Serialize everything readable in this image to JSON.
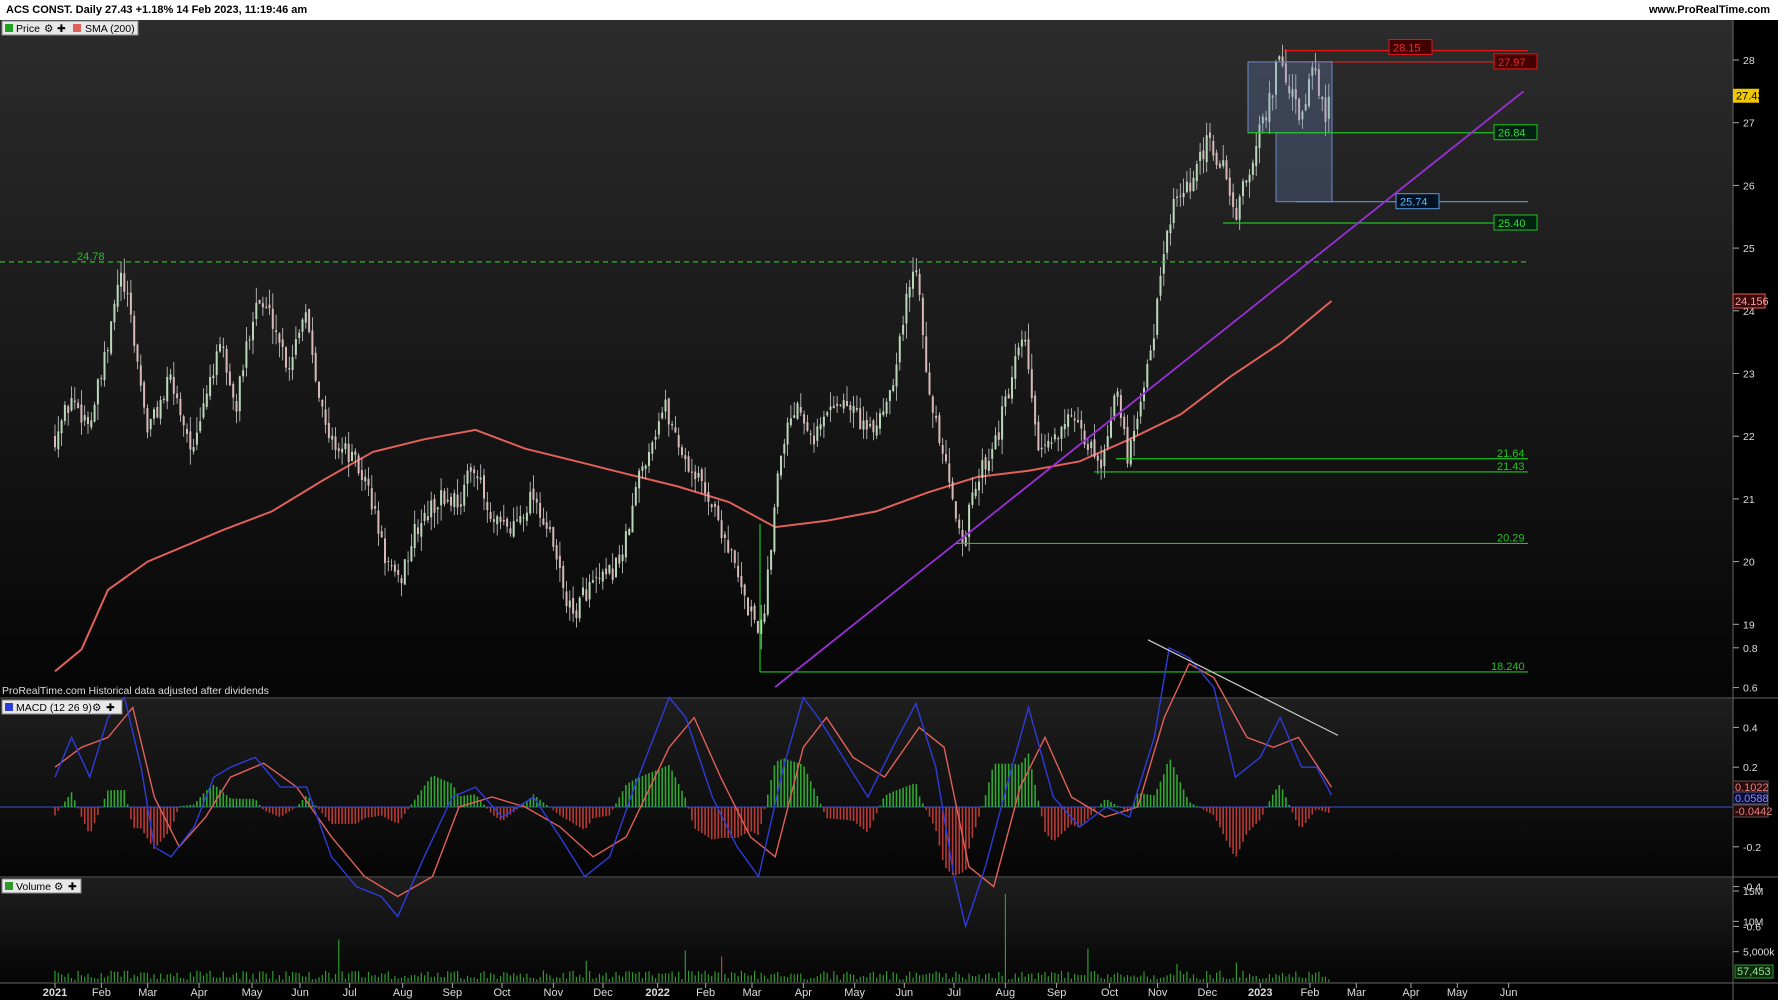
{
  "header": {
    "title": "ACS CONST. Daily 27.43 +1.18% 14 Feb 2023, 11:19:46 am",
    "site": "www.ProRealTime.com"
  },
  "footnote": "ProRealTime.com  Historical data adjusted after dividends",
  "colors": {
    "background": "#000000",
    "sma": "#e0605a",
    "trendline": "#9a2fd8",
    "support": "#22c122",
    "resistance": "#e01818",
    "macd": "#2e3cd8",
    "signal": "#e0605a",
    "hist_pos": "#2ea82e",
    "hist_neg": "#b83a36",
    "volume": "#2e9a2e",
    "box": "#4a6a9a",
    "price_tag": "#f0c800"
  },
  "panels": {
    "price": {
      "tag_label": "Price",
      "sma_label": "SMA (200)"
    },
    "macd": {
      "tag_label": "MACD (12 26 9)"
    },
    "volume": {
      "tag_label": "Volume"
    }
  },
  "chart_data": [
    {
      "type": "candlestick",
      "panel": "price",
      "ylim": [
        18.0,
        28.4
      ],
      "y_ticks": [
        19,
        20,
        21,
        22,
        23,
        24,
        25,
        26,
        27,
        28
      ],
      "x_ticks": [
        "2021",
        "Feb",
        "Mar",
        "Apr",
        "May",
        "Jun",
        "Jul",
        "Aug",
        "Sep",
        "Oct",
        "Nov",
        "Dec",
        "2022",
        "Feb",
        "Mar",
        "Apr",
        "May",
        "Jun",
        "Jul",
        "Aug",
        "Sep",
        "Oct",
        "Nov",
        "Dec",
        "2023",
        "Feb",
        "Mar",
        "Apr",
        "May",
        "Jun"
      ],
      "close_path": [
        [
          "2021-01-04",
          22.0
        ],
        [
          "2021-01-14",
          22.6
        ],
        [
          "2021-01-25",
          22.2
        ],
        [
          "2021-02-05",
          23.4
        ],
        [
          "2021-02-12",
          24.6
        ],
        [
          "2021-02-18",
          24.0
        ],
        [
          "2021-03-01",
          22.1
        ],
        [
          "2021-03-15",
          22.9
        ],
        [
          "2021-03-29",
          21.7
        ],
        [
          "2021-04-07",
          22.9
        ],
        [
          "2021-04-15",
          23.4
        ],
        [
          "2021-04-23",
          22.4
        ],
        [
          "2021-05-05",
          24.2
        ],
        [
          "2021-05-15",
          23.9
        ],
        [
          "2021-05-25",
          23.1
        ],
        [
          "2021-06-04",
          24.1
        ],
        [
          "2021-06-17",
          22.0
        ],
        [
          "2021-07-01",
          21.7
        ],
        [
          "2021-07-12",
          21.2
        ],
        [
          "2021-07-22",
          20.1
        ],
        [
          "2021-07-30",
          19.6
        ],
        [
          "2021-08-10",
          20.5
        ],
        [
          "2021-08-24",
          21.0
        ],
        [
          "2021-09-06",
          21.0
        ],
        [
          "2021-09-14",
          21.6
        ],
        [
          "2021-09-24",
          20.6
        ],
        [
          "2021-10-06",
          20.5
        ],
        [
          "2021-10-20",
          21.1
        ],
        [
          "2021-10-31",
          20.3
        ],
        [
          "2021-11-12",
          19.1
        ],
        [
          "2021-11-22",
          19.6
        ],
        [
          "2021-12-03",
          19.7
        ],
        [
          "2021-12-14",
          20.2
        ],
        [
          "2021-12-23",
          21.4
        ],
        [
          "2022-01-07",
          22.5
        ],
        [
          "2022-01-20",
          21.6
        ],
        [
          "2022-02-02",
          21.1
        ],
        [
          "2022-02-14",
          20.3
        ],
        [
          "2022-02-24",
          19.4
        ],
        [
          "2022-03-07",
          18.9
        ],
        [
          "2022-03-18",
          21.8
        ],
        [
          "2022-03-28",
          22.6
        ],
        [
          "2022-04-08",
          22.0
        ],
        [
          "2022-04-20",
          22.6
        ],
        [
          "2022-05-02",
          22.4
        ],
        [
          "2022-05-12",
          22.0
        ],
        [
          "2022-05-24",
          22.8
        ],
        [
          "2022-06-04",
          24.4
        ],
        [
          "2022-06-09",
          24.8
        ],
        [
          "2022-06-16",
          22.6
        ],
        [
          "2022-06-25",
          21.6
        ],
        [
          "2022-07-01",
          20.8
        ],
        [
          "2022-07-07",
          20.4
        ],
        [
          "2022-07-15",
          21.3
        ],
        [
          "2022-07-28",
          22.1
        ],
        [
          "2022-08-12",
          23.6
        ],
        [
          "2022-08-22",
          21.6
        ],
        [
          "2022-09-06",
          22.3
        ],
        [
          "2022-09-19",
          21.9
        ],
        [
          "2022-09-29",
          21.6
        ],
        [
          "2022-10-06",
          22.8
        ],
        [
          "2022-10-14",
          21.7
        ],
        [
          "2022-10-28",
          23.4
        ],
        [
          "2022-11-09",
          25.6
        ],
        [
          "2022-11-22",
          26.0
        ],
        [
          "2022-12-01",
          26.7
        ],
        [
          "2022-12-12",
          26.2
        ],
        [
          "2022-12-18",
          25.5
        ],
        [
          "2022-12-28",
          26.4
        ],
        [
          "2023-01-09",
          27.5
        ],
        [
          "2023-01-13",
          28.0
        ],
        [
          "2023-01-20",
          27.5
        ],
        [
          "2023-01-27",
          27.0
        ],
        [
          "2023-02-03",
          27.9
        ],
        [
          "2023-02-10",
          27.1
        ],
        [
          "2023-02-14",
          27.43
        ]
      ],
      "sma_200": [
        [
          "2021-01-04",
          18.25
        ],
        [
          "2021-01-20",
          18.6
        ],
        [
          "2021-02-05",
          19.55
        ],
        [
          "2021-03-01",
          20.0
        ],
        [
          "2021-04-15",
          20.5
        ],
        [
          "2021-05-15",
          20.8
        ],
        [
          "2021-06-15",
          21.3
        ],
        [
          "2021-07-15",
          21.75
        ],
        [
          "2021-08-15",
          21.95
        ],
        [
          "2021-09-15",
          22.1
        ],
        [
          "2021-10-15",
          21.8
        ],
        [
          "2021-11-15",
          21.6
        ],
        [
          "2021-12-15",
          21.4
        ],
        [
          "2022-01-15",
          21.2
        ],
        [
          "2022-02-15",
          20.95
        ],
        [
          "2022-03-15",
          20.55
        ],
        [
          "2022-04-15",
          20.65
        ],
        [
          "2022-05-15",
          20.8
        ],
        [
          "2022-06-15",
          21.1
        ],
        [
          "2022-07-15",
          21.35
        ],
        [
          "2022-08-15",
          21.45
        ],
        [
          "2022-09-15",
          21.6
        ],
        [
          "2022-10-15",
          21.95
        ],
        [
          "2022-11-15",
          22.35
        ],
        [
          "2022-12-15",
          22.95
        ],
        [
          "2023-01-15",
          23.5
        ],
        [
          "2023-02-14",
          24.156
        ]
      ],
      "levels": [
        {
          "label": "24.78",
          "value": 24.78,
          "style": "dashed"
        },
        {
          "label": "27.97",
          "value": 27.97,
          "style": "resistance"
        },
        {
          "label": "28.15",
          "value": 28.15,
          "style": "resistance"
        },
        {
          "label": "26.84",
          "value": 26.84,
          "style": "support"
        },
        {
          "label": "25.74",
          "value": 25.74,
          "style": "box"
        },
        {
          "label": "25.40",
          "value": 25.4,
          "style": "support"
        },
        {
          "label": "21.64",
          "value": 21.64,
          "style": "support"
        },
        {
          "label": "21.43",
          "value": 21.43,
          "style": "support"
        },
        {
          "label": "20.29",
          "value": 20.29,
          "style": "support"
        },
        {
          "label": "18.240",
          "value": 18.24,
          "style": "support"
        }
      ],
      "trendline": [
        [
          "2022-03-15",
          18.0
        ],
        [
          "2023-06-10",
          27.5
        ]
      ],
      "last_price": "27.43",
      "sma_last": "24.156"
    },
    {
      "type": "line",
      "panel": "macd",
      "ylim": [
        -0.7,
        0.9
      ],
      "y_ticks": [
        "0.8",
        "0.6",
        "0.4",
        "0.2",
        "0",
        "-0.2",
        "-0.4",
        "-0.6"
      ],
      "macd": [
        [
          "2021-01-04",
          0.15
        ],
        [
          "2021-01-14",
          0.35
        ],
        [
          "2021-01-25",
          0.15
        ],
        [
          "2021-02-05",
          0.45
        ],
        [
          "2021-02-15",
          0.55
        ],
        [
          "2021-02-25",
          0.2
        ],
        [
          "2021-03-05",
          -0.2
        ],
        [
          "2021-03-15",
          -0.25
        ],
        [
          "2021-03-29",
          -0.1
        ],
        [
          "2021-04-10",
          0.15
        ],
        [
          "2021-04-20",
          0.2
        ],
        [
          "2021-05-05",
          0.25
        ],
        [
          "2021-05-20",
          0.1
        ],
        [
          "2021-06-05",
          0.1
        ],
        [
          "2021-06-20",
          -0.25
        ],
        [
          "2021-07-05",
          -0.4
        ],
        [
          "2021-07-20",
          -0.45
        ],
        [
          "2021-07-30",
          -0.55
        ],
        [
          "2021-08-15",
          -0.25
        ],
        [
          "2021-09-01",
          0.05
        ],
        [
          "2021-09-15",
          0.1
        ],
        [
          "2021-10-01",
          -0.05
        ],
        [
          "2021-10-20",
          0.05
        ],
        [
          "2021-11-05",
          -0.15
        ],
        [
          "2021-11-20",
          -0.35
        ],
        [
          "2021-12-05",
          -0.25
        ],
        [
          "2021-12-20",
          0.1
        ],
        [
          "2022-01-10",
          0.55
        ],
        [
          "2022-01-20",
          0.45
        ],
        [
          "2022-02-05",
          0.05
        ],
        [
          "2022-02-20",
          -0.2
        ],
        [
          "2022-03-05",
          -0.35
        ],
        [
          "2022-03-20",
          0.2
        ],
        [
          "2022-04-01",
          0.55
        ],
        [
          "2022-04-10",
          0.45
        ],
        [
          "2022-04-25",
          0.25
        ],
        [
          "2022-05-10",
          0.05
        ],
        [
          "2022-05-25",
          0.3
        ],
        [
          "2022-06-08",
          0.52
        ],
        [
          "2022-06-20",
          0.2
        ],
        [
          "2022-07-01",
          -0.35
        ],
        [
          "2022-07-08",
          -0.6
        ],
        [
          "2022-07-20",
          -0.3
        ],
        [
          "2022-08-05",
          0.2
        ],
        [
          "2022-08-15",
          0.5
        ],
        [
          "2022-08-30",
          0.05
        ],
        [
          "2022-09-15",
          -0.1
        ],
        [
          "2022-10-01",
          0.0
        ],
        [
          "2022-10-15",
          -0.05
        ],
        [
          "2022-10-30",
          0.35
        ],
        [
          "2022-11-08",
          0.8
        ],
        [
          "2022-11-20",
          0.75
        ],
        [
          "2022-12-05",
          0.6
        ],
        [
          "2022-12-18",
          0.15
        ],
        [
          "2023-01-02",
          0.25
        ],
        [
          "2023-01-14",
          0.45
        ],
        [
          "2023-01-27",
          0.2
        ],
        [
          "2023-02-05",
          0.2
        ],
        [
          "2023-02-14",
          0.06
        ]
      ],
      "signal": [
        [
          "2021-01-04",
          0.2
        ],
        [
          "2021-01-20",
          0.3
        ],
        [
          "2021-02-05",
          0.35
        ],
        [
          "2021-02-20",
          0.5
        ],
        [
          "2021-03-05",
          0.05
        ],
        [
          "2021-03-20",
          -0.2
        ],
        [
          "2021-04-05",
          -0.05
        ],
        [
          "2021-04-20",
          0.15
        ],
        [
          "2021-05-10",
          0.22
        ],
        [
          "2021-05-30",
          0.1
        ],
        [
          "2021-06-20",
          -0.15
        ],
        [
          "2021-07-10",
          -0.35
        ],
        [
          "2021-07-30",
          -0.45
        ],
        [
          "2021-08-20",
          -0.35
        ],
        [
          "2021-09-05",
          0.0
        ],
        [
          "2021-09-25",
          0.05
        ],
        [
          "2021-10-15",
          0.0
        ],
        [
          "2021-11-05",
          -0.1
        ],
        [
          "2021-11-25",
          -0.25
        ],
        [
          "2021-12-15",
          -0.15
        ],
        [
          "2022-01-10",
          0.3
        ],
        [
          "2022-01-25",
          0.45
        ],
        [
          "2022-02-10",
          0.15
        ],
        [
          "2022-02-28",
          -0.15
        ],
        [
          "2022-03-15",
          -0.25
        ],
        [
          "2022-04-01",
          0.3
        ],
        [
          "2022-04-15",
          0.45
        ],
        [
          "2022-05-01",
          0.25
        ],
        [
          "2022-05-20",
          0.15
        ],
        [
          "2022-06-10",
          0.4
        ],
        [
          "2022-06-25",
          0.3
        ],
        [
          "2022-07-10",
          -0.3
        ],
        [
          "2022-07-25",
          -0.4
        ],
        [
          "2022-08-10",
          0.1
        ],
        [
          "2022-08-25",
          0.35
        ],
        [
          "2022-09-10",
          0.05
        ],
        [
          "2022-09-30",
          -0.05
        ],
        [
          "2022-10-20",
          0.0
        ],
        [
          "2022-11-05",
          0.45
        ],
        [
          "2022-11-20",
          0.72
        ],
        [
          "2022-12-05",
          0.65
        ],
        [
          "2022-12-25",
          0.35
        ],
        [
          "2023-01-10",
          0.3
        ],
        [
          "2023-01-25",
          0.35
        ],
        [
          "2023-02-14",
          0.1
        ]
      ],
      "value_tags": [
        "0.1022",
        "0.0588",
        "-0.0442"
      ]
    },
    {
      "type": "bar",
      "panel": "volume",
      "ylim": [
        0,
        16000000
      ],
      "y_ticks": [
        "15M",
        "10M",
        "5,000k"
      ],
      "spikes": [
        [
          "2021-06-24",
          7000000
        ],
        [
          "2021-11-20",
          3500000
        ],
        [
          "2022-01-20",
          5200000
        ],
        [
          "2022-02-10",
          4200000
        ],
        [
          "2022-08-01",
          14500000
        ],
        [
          "2022-09-20",
          5500000
        ],
        [
          "2022-11-12",
          3000000
        ],
        [
          "2022-12-18",
          3200000
        ]
      ],
      "last_volume": "57,453"
    }
  ]
}
